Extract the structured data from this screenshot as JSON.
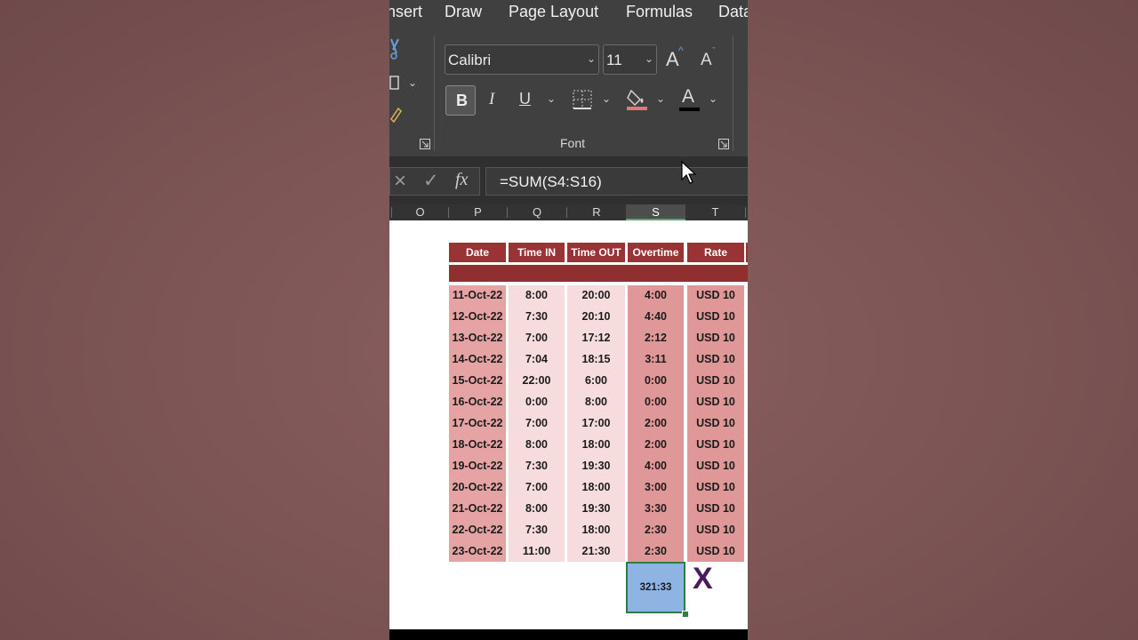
{
  "ribbon": {
    "tabs": [
      "nsert",
      "Draw",
      "Page Layout",
      "Formulas",
      "Data"
    ],
    "font_name": "Calibri",
    "font_size": "11",
    "bold_label": "B",
    "italic_label": "I",
    "underline_label": "U",
    "increase_font_label": "A",
    "decrease_font_label": "A",
    "font_color_label": "A",
    "group_label": "Font",
    "fill_color": "#e07a7a",
    "font_color": "#000000"
  },
  "formula_bar": {
    "cancel_label": "×",
    "enter_label": "✓",
    "fx_label": "fx",
    "formula": "=SUM(S4:S16)"
  },
  "columns": [
    "O",
    "P",
    "Q",
    "R",
    "S",
    "T"
  ],
  "selected_column": "S",
  "table": {
    "headers": [
      "Date",
      "Time IN",
      "Time OUT",
      "Overtime",
      "Rate"
    ],
    "rows": [
      [
        "11-Oct-22",
        "8:00",
        "20:00",
        "4:00",
        "USD 10"
      ],
      [
        "12-Oct-22",
        "7:30",
        "20:10",
        "4:40",
        "USD 10"
      ],
      [
        "13-Oct-22",
        "7:00",
        "17:12",
        "2:12",
        "USD 10"
      ],
      [
        "14-Oct-22",
        "7:04",
        "18:15",
        "3:11",
        "USD 10"
      ],
      [
        "15-Oct-22",
        "22:00",
        "6:00",
        "0:00",
        "USD 10"
      ],
      [
        "16-Oct-22",
        "0:00",
        "8:00",
        "0:00",
        "USD 10"
      ],
      [
        "17-Oct-22",
        "7:00",
        "17:00",
        "2:00",
        "USD 10"
      ],
      [
        "18-Oct-22",
        "8:00",
        "18:00",
        "2:00",
        "USD 10"
      ],
      [
        "19-Oct-22",
        "7:30",
        "19:30",
        "4:00",
        "USD 10"
      ],
      [
        "20-Oct-22",
        "7:00",
        "18:00",
        "3:00",
        "USD 10"
      ],
      [
        "21-Oct-22",
        "8:00",
        "19:30",
        "3:30",
        "USD 10"
      ],
      [
        "22-Oct-22",
        "7:30",
        "18:00",
        "2:30",
        "USD 10"
      ],
      [
        "23-Oct-22",
        "11:00",
        "21:30",
        "2:30",
        "USD 10"
      ]
    ],
    "total": "321:33",
    "error_mark": "X"
  },
  "colors": {
    "header_red": "#9a3335",
    "band_red": "#8f2f30",
    "date_col": "#e6a3a3",
    "light_col": "#f6dcdc",
    "overtime_col": "#e09797",
    "total_fill": "#8eb4e3",
    "selection_green": "#2e7d46",
    "mark_purple": "#4a1a5c"
  }
}
